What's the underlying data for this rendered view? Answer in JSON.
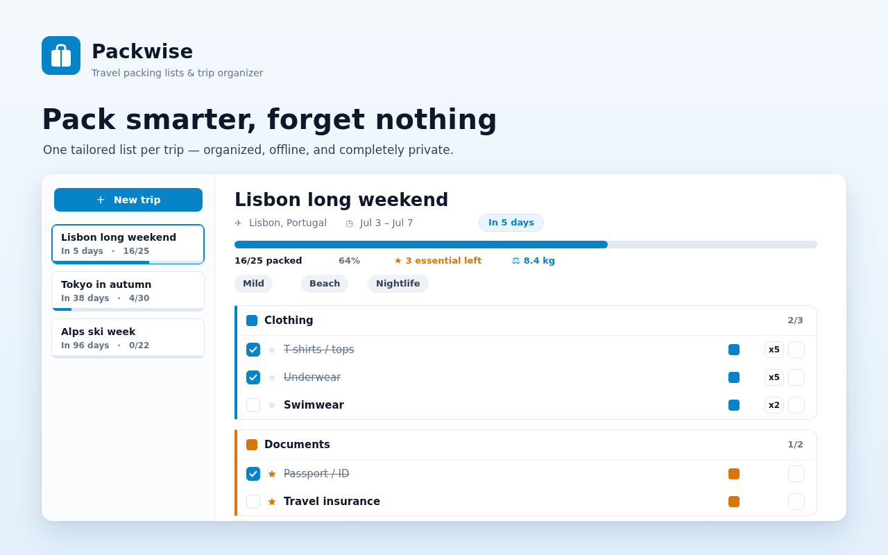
{
  "app": {
    "name": "Packwise",
    "tagline": "Travel packing lists & trip organizer"
  },
  "hero": {
    "title": "Pack smarter, forget nothing",
    "subtitle": "One tailored list per trip — organized, offline, and completely private."
  },
  "sidebar": {
    "new_trip_button": {
      "icon": "+",
      "label": "New trip"
    },
    "trips": [
      {
        "name": "Lisbon long weekend",
        "countdown": "In 5 days",
        "separator": "·",
        "count": "16/25",
        "level": 0.64,
        "selected": true
      },
      {
        "name": "Tokyo in autumn",
        "countdown": "In 38 days",
        "separator": "·",
        "count": "4/30",
        "level": 0.13,
        "selected": false
      },
      {
        "name": "Alps ski week",
        "countdown": "In 96 days",
        "separator": "·",
        "count": "0/22",
        "level": 0,
        "selected": false
      }
    ]
  },
  "trip": {
    "title": "Lisbon long weekend",
    "location_icon": "✈",
    "location": "Lisbon, Portugal",
    "dates_icon": "◷",
    "dates": "Jul 3 – Jul 7",
    "countdown_badge": "In 5 days",
    "level": 0.64,
    "stats": {
      "packed": "16/25 packed",
      "percent": "64%",
      "essential_icon": "★",
      "essential_left": "3 essential left",
      "weight_icon": "⚖",
      "weight": "8.4 kg"
    },
    "tags": [
      "Mild",
      "Beach",
      "Nightlife"
    ],
    "categories": [
      {
        "name": "Clothing",
        "color": "#0784c7",
        "count": "2/3",
        "items": [
          {
            "name": "T-shirts / tops",
            "checked": true,
            "essential": false,
            "quantity": "x5"
          },
          {
            "name": "Underwear",
            "checked": true,
            "essential": false,
            "quantity": "x5"
          },
          {
            "name": "Swimwear",
            "checked": false,
            "essential": false,
            "quantity": "x2"
          }
        ]
      },
      {
        "name": "Documents",
        "color": "#d97706",
        "count": "1/2",
        "items": [
          {
            "name": "Passport / ID",
            "checked": true,
            "essential": true
          },
          {
            "name": "Travel insurance",
            "checked": false,
            "essential": true
          }
        ]
      }
    ]
  }
}
